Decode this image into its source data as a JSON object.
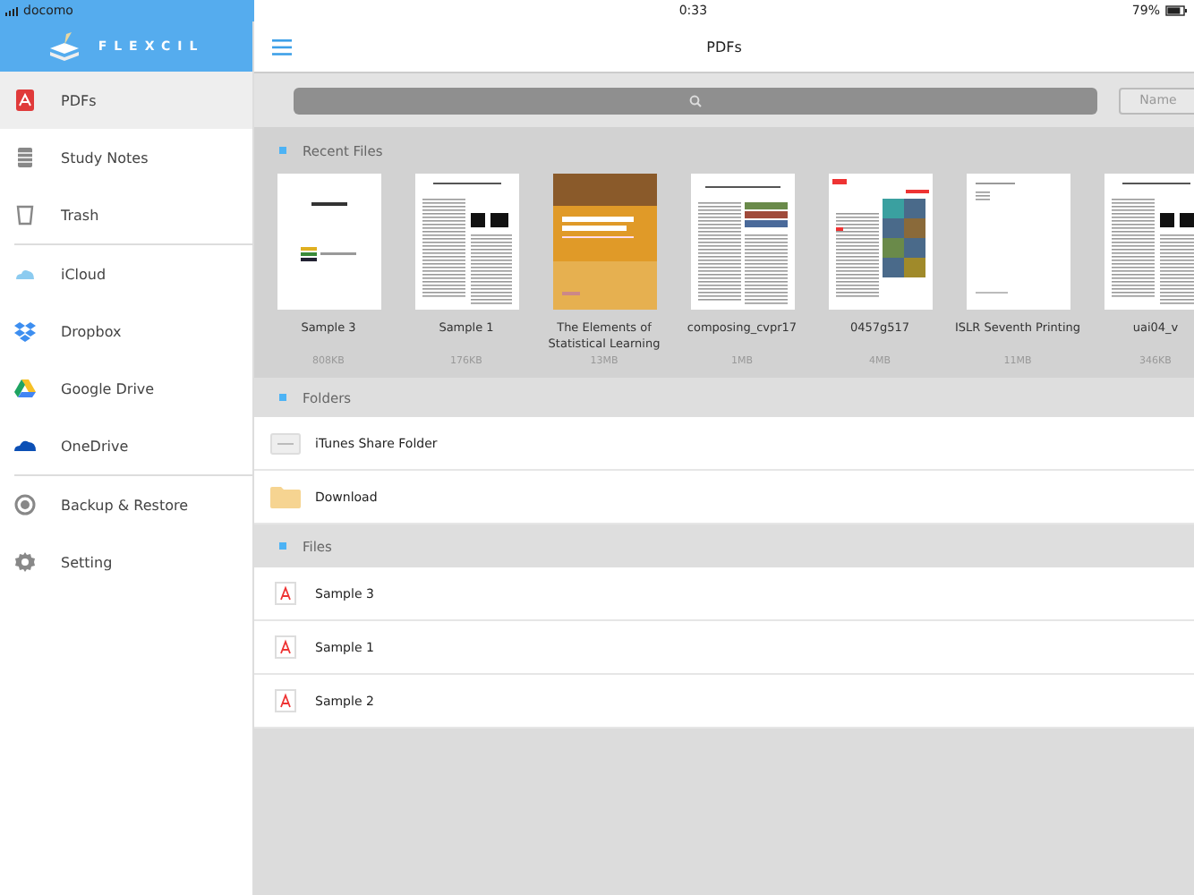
{
  "status_bar": {
    "carrier": "docomo",
    "time": "0:33",
    "battery": "79%"
  },
  "sidebar": {
    "logo": "FLEXCIL",
    "groups": [
      [
        {
          "label": "PDFs",
          "kind": "pdf",
          "selected": true
        },
        {
          "label": "Study Notes",
          "kind": "notes",
          "selected": false
        },
        {
          "label": "Trash",
          "kind": "trash",
          "selected": false
        }
      ],
      [
        {
          "label": "iCloud",
          "kind": "icloud",
          "selected": false
        },
        {
          "label": "Dropbox",
          "kind": "dropbox",
          "selected": false
        },
        {
          "label": "Google Drive",
          "kind": "gdrive",
          "selected": false
        },
        {
          "label": "OneDrive",
          "kind": "onedrive",
          "selected": false
        }
      ],
      [
        {
          "label": "Backup & Restore",
          "kind": "backup",
          "selected": false
        },
        {
          "label": "Setting",
          "kind": "gear",
          "selected": false
        }
      ]
    ]
  },
  "header": {
    "title": "PDFs"
  },
  "toolbar": {
    "sort_button": "Name"
  },
  "recent": {
    "title": "Recent Files",
    "items": [
      {
        "name": "Sample 3",
        "size": "808KB",
        "kind": "title-page"
      },
      {
        "name": "Sample 1",
        "size": "176KB",
        "kind": "text-page"
      },
      {
        "name": "The Elements of Statistical Learning",
        "size": "13MB",
        "kind": "book-cover"
      },
      {
        "name": "composing_cvpr17",
        "size": "1MB",
        "kind": "photo-page"
      },
      {
        "name": "0457g517",
        "size": "4MB",
        "kind": "annotated-page"
      },
      {
        "name": "ISLR Seventh Printing",
        "size": "11MB",
        "kind": "blank-page"
      },
      {
        "name": "uai04_v",
        "size": "346KB",
        "kind": "text-page"
      }
    ]
  },
  "folders": {
    "title": "Folders",
    "items": [
      {
        "name": "iTunes Share Folder",
        "kind": "itunes"
      },
      {
        "name": "Download",
        "kind": "folder"
      }
    ]
  },
  "files": {
    "title": "Files",
    "items": [
      {
        "name": "Sample 3"
      },
      {
        "name": "Sample 1"
      },
      {
        "name": "Sample 2"
      }
    ]
  }
}
